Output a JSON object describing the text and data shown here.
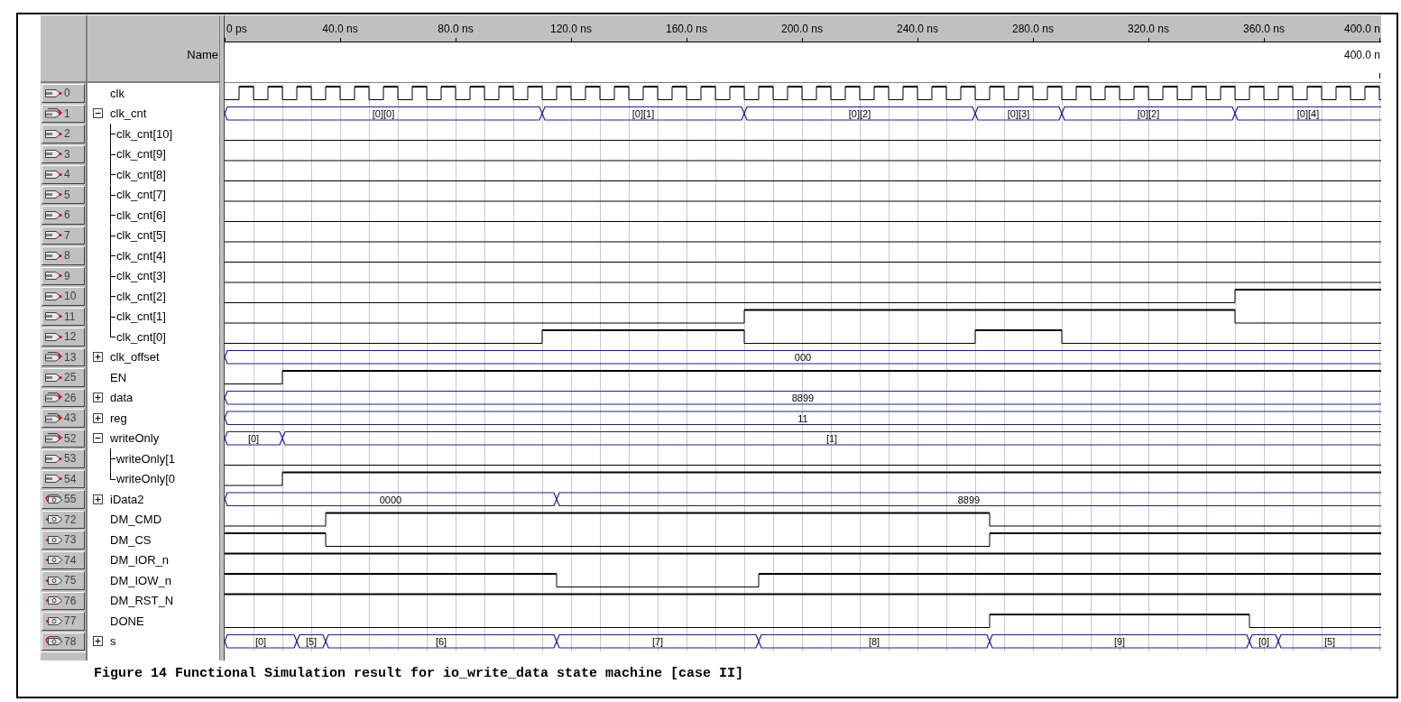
{
  "ruler": {
    "labels": [
      "0 ps",
      "40.0 ns",
      "80.0 ns",
      "120.0 ns",
      "160.0 ns",
      "200.0 ns",
      "240.0 ns",
      "280.0 ns",
      "320.0 ns",
      "360.0 ns",
      "400.0 n"
    ]
  },
  "name_header": "Name",
  "cursor_label": "400.0 n",
  "signals": [
    {
      "index": "0",
      "name": "clk",
      "kind": "input_clock"
    },
    {
      "index": "1",
      "name": "clk_cnt",
      "kind": "input_bus",
      "expanded": true,
      "values": [
        "[0][0]",
        "[0][1]",
        "[0][2]",
        "[0][3]",
        "[0][2]",
        "[0][4]"
      ],
      "children": [
        {
          "index": "2",
          "name": "clk_cnt[10]",
          "kind": "input_bit"
        },
        {
          "index": "3",
          "name": "clk_cnt[9]",
          "kind": "input_bit"
        },
        {
          "index": "4",
          "name": "clk_cnt[8]",
          "kind": "input_bit"
        },
        {
          "index": "5",
          "name": "clk_cnt[7]",
          "kind": "input_bit"
        },
        {
          "index": "6",
          "name": "clk_cnt[6]",
          "kind": "input_bit"
        },
        {
          "index": "7",
          "name": "clk_cnt[5]",
          "kind": "input_bit"
        },
        {
          "index": "8",
          "name": "clk_cnt[4]",
          "kind": "input_bit"
        },
        {
          "index": "9",
          "name": "clk_cnt[3]",
          "kind": "input_bit"
        },
        {
          "index": "10",
          "name": "clk_cnt[2]",
          "kind": "input_bit"
        },
        {
          "index": "11",
          "name": "clk_cnt[1]",
          "kind": "input_bit"
        },
        {
          "index": "12",
          "name": "clk_cnt[0]",
          "kind": "input_bit"
        }
      ]
    },
    {
      "index": "13",
      "name": "clk_offset",
      "kind": "input_bus",
      "expanded": false,
      "values": [
        "000"
      ]
    },
    {
      "index": "25",
      "name": "EN",
      "kind": "input_bit"
    },
    {
      "index": "26",
      "name": "data",
      "kind": "input_bus",
      "expanded": false,
      "values": [
        "8899"
      ]
    },
    {
      "index": "43",
      "name": "reg",
      "kind": "input_bus",
      "expanded": false,
      "values": [
        "11"
      ]
    },
    {
      "index": "52",
      "name": "writeOnly",
      "kind": "input_bus",
      "expanded": true,
      "values": [
        "[0]",
        "[1]"
      ],
      "children": [
        {
          "index": "53",
          "name": "writeOnly[1",
          "kind": "input_bit"
        },
        {
          "index": "54",
          "name": "writeOnly[0",
          "kind": "input_bit"
        }
      ]
    },
    {
      "index": "55",
      "name": "iData2",
      "kind": "output_bus",
      "expanded": false,
      "values": [
        "0000",
        "8899"
      ]
    },
    {
      "index": "72",
      "name": "DM_CMD",
      "kind": "output_bit"
    },
    {
      "index": "73",
      "name": "DM_CS",
      "kind": "output_bit"
    },
    {
      "index": "74",
      "name": "DM_IOR_n",
      "kind": "output_bit"
    },
    {
      "index": "75",
      "name": "DM_IOW_n",
      "kind": "output_bit"
    },
    {
      "index": "76",
      "name": "DM_RST_N",
      "kind": "output_bit"
    },
    {
      "index": "77",
      "name": "DONE",
      "kind": "output_bit"
    },
    {
      "index": "78",
      "name": "s",
      "kind": "output_bus",
      "expanded": false,
      "values": [
        "[0]",
        "[5]",
        "[6]",
        "[7]",
        "[8]",
        "[9]",
        "[0]",
        "[5]"
      ]
    }
  ],
  "caption": "Figure 14 Functional Simulation result for io_write_data state machine [case II]"
}
